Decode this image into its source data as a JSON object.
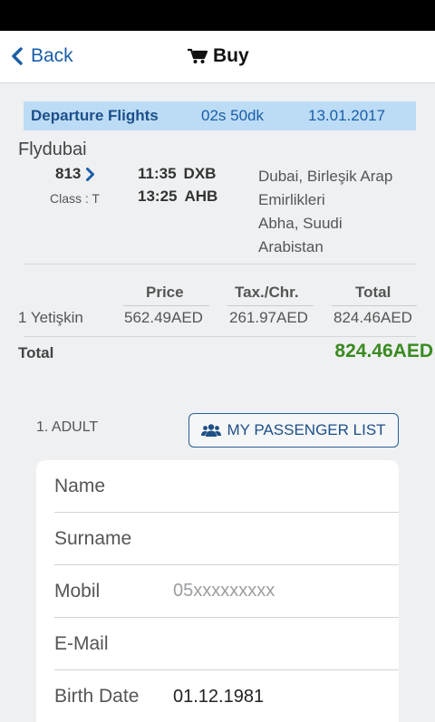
{
  "nav": {
    "back_label": "Back",
    "title": "Buy"
  },
  "flight_bar": {
    "title": "Departure Flights",
    "duration": "02s 50dk",
    "date": "13.01.2017"
  },
  "flight": {
    "airline": "Flydubai",
    "number": "813",
    "class_label": "Class : T",
    "departure_time": "11:35",
    "departure_code": "DXB",
    "arrival_time": "13:25",
    "arrival_code": "AHB",
    "route_lines": [
      "Dubai, Birleşik Arap",
      "Emirlikleri",
      "Abha, Suudi",
      "Arabistan"
    ]
  },
  "price_table": {
    "headers": [
      "Price",
      "Tax./Chr.",
      "Total"
    ],
    "rows": [
      {
        "label": "1 Yetişkin",
        "price": "562.49AED",
        "tax": "261.97AED",
        "total": "824.46AED"
      }
    ]
  },
  "grand_total": {
    "label": "Total",
    "value": "824.46AED"
  },
  "passenger": {
    "section_label": "1. ADULT",
    "list_button": "MY PASSENGER LIST"
  },
  "form": {
    "name_label": "Name",
    "surname_label": "Surname",
    "mobile_label": "Mobil",
    "mobile_placeholder": "05xxxxxxxxx",
    "email_label": "E-Mail",
    "birth_label": "Birth Date",
    "birth_value": "01.12.1981"
  },
  "colors": {
    "accent": "#1a5ea8",
    "header_bar": "#bcdcf5",
    "total_green": "#3a8a1f"
  },
  "icons": {
    "back": "chevron-left-icon",
    "cart": "cart-icon",
    "flight_detail": "chevron-right-icon",
    "passengers": "users-icon"
  }
}
